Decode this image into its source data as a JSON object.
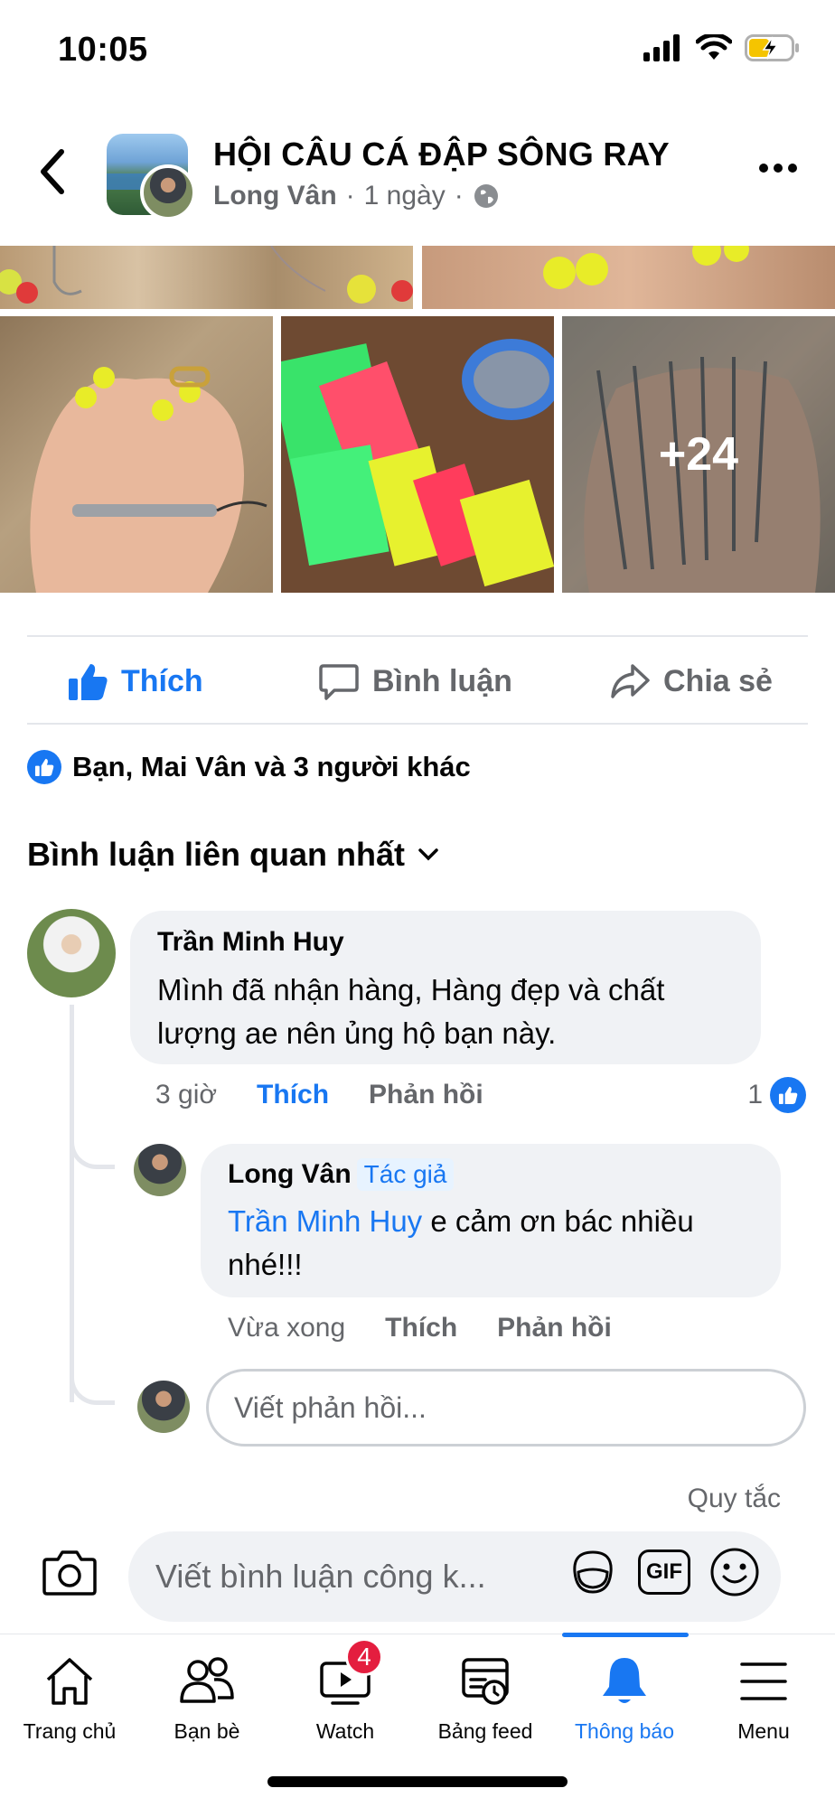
{
  "status_bar": {
    "time": "10:05",
    "icons": [
      "signal-icon",
      "wifi-icon",
      "battery-charging-icon"
    ]
  },
  "header": {
    "group_name": "HỘI CÂU CÁ ĐẬP SÔNG RAY",
    "author": "Long Vân",
    "time": "1 ngày",
    "separator": "·",
    "privacy_icon": "globe-icon"
  },
  "photos": {
    "more_count": "+24"
  },
  "actions": {
    "like": "Thích",
    "comment": "Bình luận",
    "share": "Chia sẻ"
  },
  "reactions": {
    "summary": "Bạn, Mai Vân và 3 người khác"
  },
  "comments_filter": {
    "label": "Bình luận liên quan nhất"
  },
  "comments": [
    {
      "name": "Trần Minh Huy",
      "text_line1": "Mình đã nhận hàng, Hàng đẹp và chất",
      "text_line2": "lượng ae nên ủng hộ bạn này.",
      "time": "3 giờ",
      "like": "Thích",
      "reply": "Phản hồi",
      "like_count": "1"
    }
  ],
  "reply": {
    "name": "Long Vân",
    "author_tag": "Tác giả",
    "mention": "Trần Minh Huy",
    "text_line1": " e cảm ơn bác nhiều",
    "text_line2": "nhé!!!",
    "time": "Vừa xong",
    "like": "Thích",
    "reply": "Phản hồi"
  },
  "reply_input": {
    "placeholder": "Viết phản hồi..."
  },
  "rules_link": "Quy tắc",
  "composer": {
    "placeholder": "Viết bình luận công k...",
    "gif_label": "GIF"
  },
  "bottom_nav": {
    "items": [
      {
        "label": "Trang chủ",
        "icon": "home-icon"
      },
      {
        "label": "Bạn bè",
        "icon": "friends-icon"
      },
      {
        "label": "Watch",
        "icon": "watch-icon",
        "badge": "4"
      },
      {
        "label": "Bảng feed",
        "icon": "feed-icon"
      },
      {
        "label": "Thông báo",
        "icon": "bell-icon",
        "active": true
      },
      {
        "label": "Menu",
        "icon": "menu-icon"
      }
    ]
  },
  "colors": {
    "accent": "#1877f2",
    "text_secondary": "#65676b",
    "bubble": "#f0f2f5",
    "badge": "#e41e3f"
  }
}
